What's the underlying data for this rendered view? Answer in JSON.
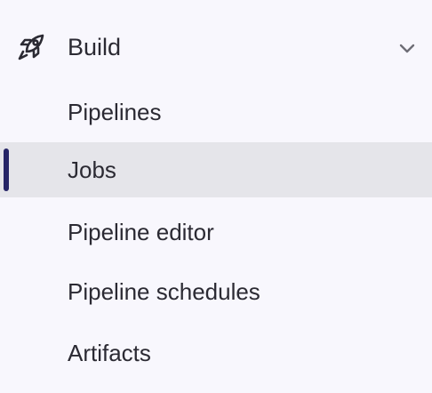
{
  "section": {
    "label": "Build",
    "icon": "rocket-icon",
    "expanded": true
  },
  "items": [
    {
      "label": "Pipelines",
      "active": false
    },
    {
      "label": "Jobs",
      "active": true
    },
    {
      "label": "Pipeline editor",
      "active": false
    },
    {
      "label": "Pipeline schedules",
      "active": false
    },
    {
      "label": "Artifacts",
      "active": false
    }
  ],
  "colors": {
    "background": "#f8f7fd",
    "active_background": "#e5e5ea",
    "active_marker": "#252466",
    "text": "#2b2a33"
  }
}
